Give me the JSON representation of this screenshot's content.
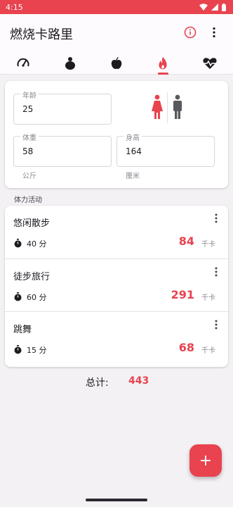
{
  "status_bar": {
    "time": "4:15",
    "icons": [
      "wifi-icon",
      "signal-icon",
      "battery-icon"
    ]
  },
  "app_bar": {
    "title": "燃烧卡路里",
    "actions": [
      "info-icon",
      "more-vert-icon"
    ]
  },
  "tabs": [
    {
      "icon": "speedometer-icon",
      "active": false
    },
    {
      "icon": "body-weight-icon",
      "active": false
    },
    {
      "icon": "apple-icon",
      "active": false
    },
    {
      "icon": "flame-icon",
      "active": true
    },
    {
      "icon": "heart-pulse-icon",
      "active": false
    }
  ],
  "profile": {
    "age": {
      "label": "年龄",
      "value": "25"
    },
    "weight": {
      "label": "体重",
      "value": "58",
      "unit": "公斤"
    },
    "height": {
      "label": "身高",
      "value": "164",
      "unit": "厘米"
    },
    "gender": {
      "female_icon": "female-icon",
      "male_icon": "male-icon",
      "selected": "female"
    }
  },
  "activities_section": {
    "label": "体力活动"
  },
  "activities": [
    {
      "name": "悠闲散步",
      "duration": "40 分",
      "calories": "84",
      "unit": "千卡"
    },
    {
      "name": "徒步旅行",
      "duration": "60 分",
      "calories": "291",
      "unit": "千卡"
    },
    {
      "name": "跳舞",
      "duration": "15 分",
      "calories": "68",
      "unit": "千卡"
    }
  ],
  "total": {
    "label": "总计:",
    "value": "443"
  },
  "fab": {
    "label": "+"
  },
  "colors": {
    "accent": "#e8434f",
    "background": "#f3f1f4",
    "card": "#ffffff",
    "male_icon": "#5a5a5e"
  }
}
